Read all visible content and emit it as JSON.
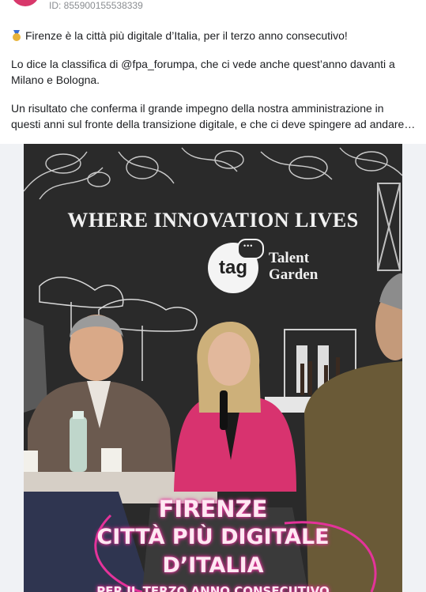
{
  "post": {
    "id_line": "ID: 855900155538339",
    "avatar_icon": "avatar",
    "paragraphs": [
      "Firenze è la città più digitale d’Italia, per il terzo anno consecutivo!",
      "Lo dice la classifica di @fpa_forumpa, che ci vede anche quest’anno davanti a Milano e Bologna.",
      "Un risultato che conferma il grande impegno della nostra amministrazione in questi anni sul fronte della transizione digitale, e che ci deve spingere ad andare…"
    ],
    "medal_icon": "medal-icon"
  },
  "photo": {
    "wall_heading": "WHERE INNOVATION LIVES",
    "logo_mark": "tag",
    "logo_line1": "Talent",
    "logo_line2": "Garden",
    "overlay_line1": "FIRENZE",
    "overlay_line2": "CITTÀ PIÙ DIGITALE",
    "overlay_line3": "D’ITALIA",
    "overlay_line4": "PER IL TERZO ANNO CONSECUTIVO",
    "accent_color": "#e4339a"
  }
}
